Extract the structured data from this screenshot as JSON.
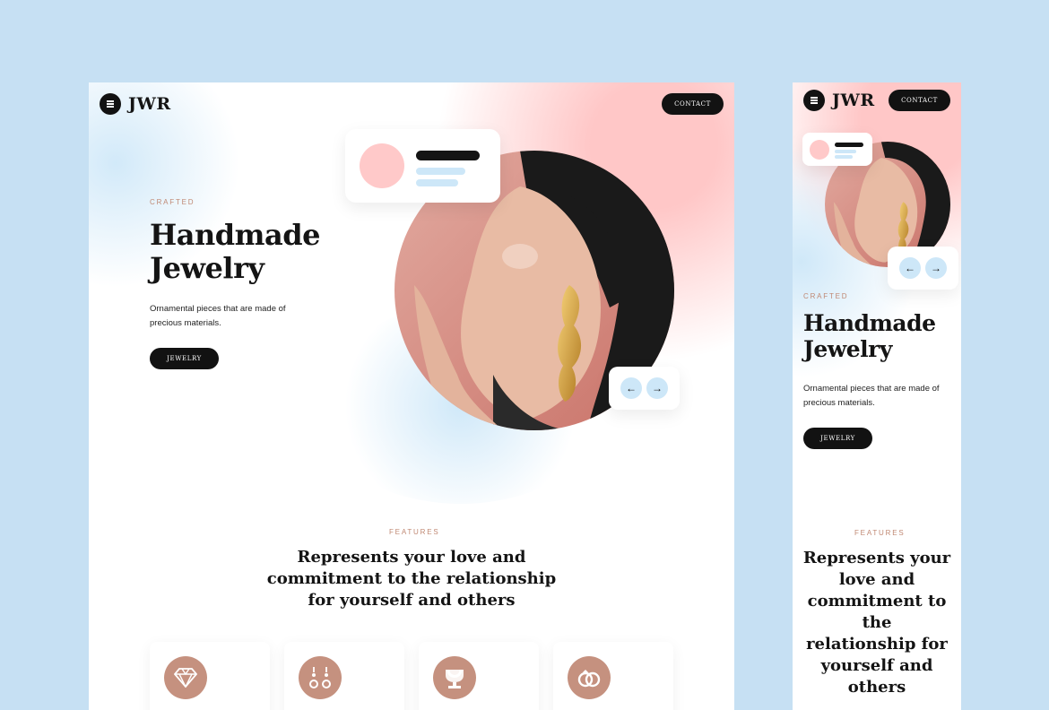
{
  "brand": {
    "logo": "JWR"
  },
  "nav": {
    "contact_label": "CONTACT"
  },
  "hero": {
    "eyebrow": "CRAFTED",
    "title_line1": "Handmade",
    "title_line2": "Jewelry",
    "description_line1": "Ornamental pieces that are made of",
    "description_line2": "precious materials.",
    "cta_label": "JEWELRY",
    "arrows": {
      "prev": "←",
      "next": "→"
    }
  },
  "features": {
    "eyebrow": "FEATURES",
    "heading_desktop": [
      "Represents your love and",
      "commitment to the relationship",
      "for yourself and others"
    ],
    "heading_mobile": [
      "Represents your",
      "love and",
      "commitment to the",
      "relationship for",
      "yourself and",
      "others"
    ],
    "cards": [
      {
        "icon": "diamond-icon"
      },
      {
        "icon": "earrings-icon"
      },
      {
        "icon": "necklace-bust-icon"
      },
      {
        "icon": "rings-icon"
      }
    ]
  },
  "colors": {
    "background": "#c6e0f3",
    "accent": "#c5917f",
    "dark": "#121212",
    "pink": "#ffc9c9",
    "light_blue": "#cde7f8"
  }
}
